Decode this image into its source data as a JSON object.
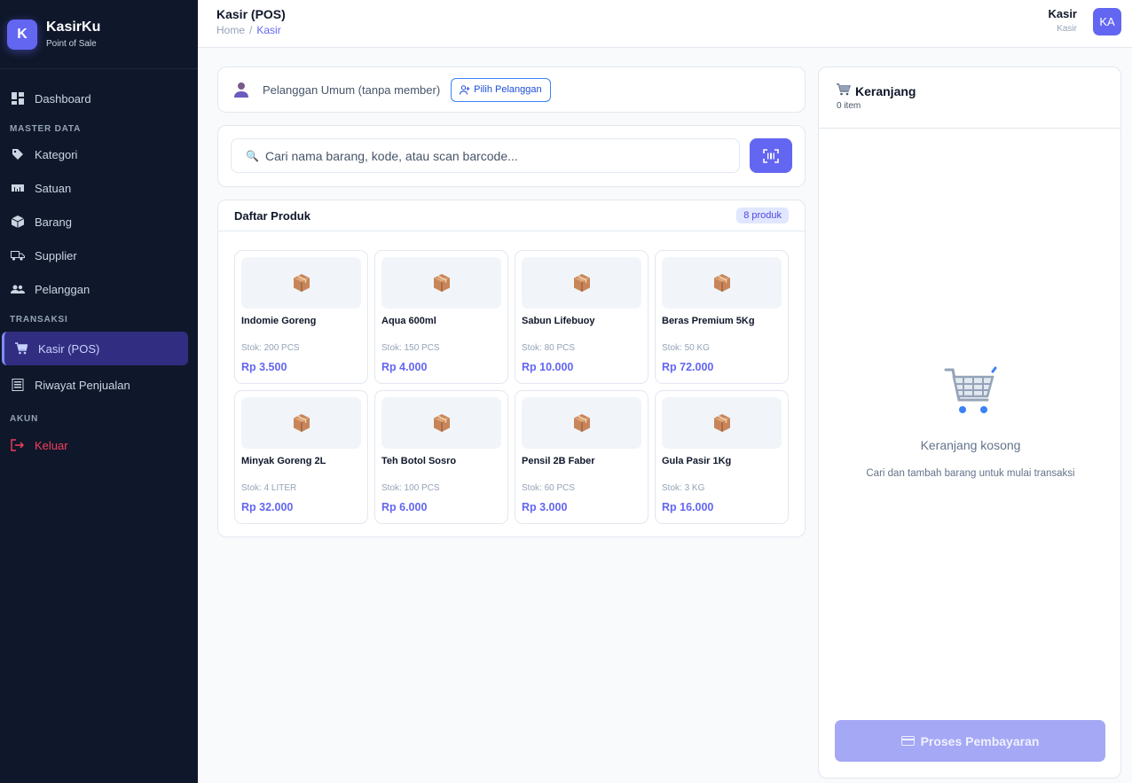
{
  "brand": {
    "logo_letter": "K",
    "name": "KasirKu",
    "subtitle": "Point of Sale"
  },
  "sidebar": {
    "dashboard": "Dashboard",
    "section_master": "MASTER DATA",
    "kategori": "Kategori",
    "satuan": "Satuan",
    "barang": "Barang",
    "supplier": "Supplier",
    "pelanggan": "Pelanggan",
    "section_transaksi": "TRANSAKSI",
    "kasir": "Kasir (POS)",
    "riwayat": "Riwayat Penjualan",
    "section_akun": "AKUN",
    "keluar": "Keluar"
  },
  "header": {
    "title": "Kasir (POS)",
    "breadcrumb_home": "Home",
    "breadcrumb_sep": "/",
    "breadcrumb_current": "Kasir",
    "user_name": "Kasir",
    "user_role": "Kasir",
    "avatar_initials": "KA"
  },
  "customer": {
    "label": "Pelanggan Umum (tanpa member)",
    "pick_button": "Pilih Pelanggan"
  },
  "search": {
    "placeholder": "Cari nama barang, kode, atau scan barcode..."
  },
  "products": {
    "title": "Daftar Produk",
    "count": "8 produk",
    "items": [
      {
        "name": "Indomie Goreng",
        "stock": "Stok: 200 PCS",
        "price": "Rp 3.500"
      },
      {
        "name": "Aqua 600ml",
        "stock": "Stok: 150 PCS",
        "price": "Rp 4.000"
      },
      {
        "name": "Sabun Lifebuoy",
        "stock": "Stok: 80 PCS",
        "price": "Rp 10.000"
      },
      {
        "name": "Beras Premium 5Kg",
        "stock": "Stok: 50 KG",
        "price": "Rp 72.000"
      },
      {
        "name": "Minyak Goreng 2L",
        "stock": "Stok: 4 LITER",
        "price": "Rp 32.000"
      },
      {
        "name": "Teh Botol Sosro",
        "stock": "Stok: 100 PCS",
        "price": "Rp 6.000"
      },
      {
        "name": "Pensil 2B Faber",
        "stock": "Stok: 60 PCS",
        "price": "Rp 3.000"
      },
      {
        "name": "Gula Pasir 1Kg",
        "stock": "Stok: 3 KG",
        "price": "Rp 16.000"
      }
    ]
  },
  "cart": {
    "title": "Keranjang",
    "count": "0 item",
    "empty_title": "Keranjang kosong",
    "empty_desc": "Cari dan tambah barang untuk mulai transaksi",
    "pay_button": "Proses Pembayaran"
  },
  "colors": {
    "accent": "#6366f1",
    "sidebar_bg": "#0f172a",
    "danger": "#f43f5e"
  }
}
